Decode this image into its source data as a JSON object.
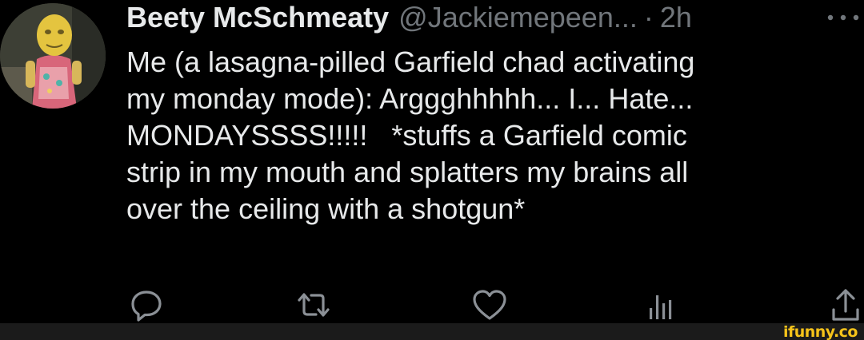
{
  "tweet": {
    "display_name": "Beety McSchmeaty",
    "handle": "@Jackiemepeen...",
    "separator": "·",
    "time": "2h",
    "text": "Me (a lasagna-pilled Garfield chad activating\nmy monday mode): Arggghhhhh... I... Hate...\nMONDAYSSSS!!!!!   *stuffs a Garfield comic\nstrip in my mouth and splatters my brains all\nover the ceiling with a shotgun*"
  },
  "icons": {
    "more": "more-icon",
    "reply": "reply-icon",
    "retweet": "retweet-icon",
    "like": "heart-icon",
    "views": "views-icon",
    "share": "share-icon"
  },
  "watermark": {
    "logo_text": "ifunny.co"
  },
  "colors": {
    "background": "#000000",
    "primary_text": "#e7e9ea",
    "secondary_text": "#71767b",
    "watermark": "#f5c31a",
    "footer_bar": "#1b1b1b"
  }
}
